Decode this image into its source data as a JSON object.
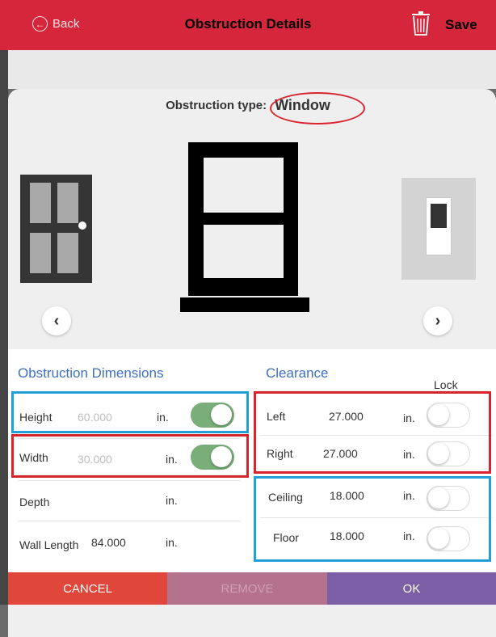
{
  "header": {
    "back_label": "Back",
    "title": "Obstruction Details",
    "save_label": "Save",
    "back_icon": "arrow-left-circle-icon",
    "trash_icon": "trash-icon",
    "color": "#d5263b"
  },
  "obstruction": {
    "type_prefix": "Obstruction type:",
    "type_value": "Window",
    "options": [
      "door",
      "window",
      "outlet"
    ],
    "selected": "window"
  },
  "nav": {
    "prev_glyph": "‹",
    "next_glyph": "›"
  },
  "dimensions": {
    "title": "Obstruction Dimensions",
    "rows": [
      {
        "label": "Height",
        "value": "60.000",
        "unit": "in.",
        "locked": true
      },
      {
        "label": "Width",
        "value": "30.000",
        "unit": "in.",
        "locked": true
      },
      {
        "label": "Depth",
        "value": "",
        "unit": "in."
      },
      {
        "label": "Wall Length",
        "value": "84.000",
        "unit": "in."
      }
    ]
  },
  "clearance": {
    "title": "Clearance",
    "lock_label": "Lock",
    "rows": [
      {
        "label": "Left",
        "value": "27.000",
        "unit": "in.",
        "locked": false
      },
      {
        "label": "Right",
        "value": "27.000",
        "unit": "in.",
        "locked": false
      },
      {
        "label": "Ceiling",
        "value": "18.000",
        "unit": "in.",
        "locked": false
      },
      {
        "label": "Floor",
        "value": "18.000",
        "unit": "in.",
        "locked": false
      }
    ]
  },
  "footer": {
    "cancel_label": "CANCEL",
    "remove_label": "REMOVE",
    "ok_label": "OK"
  },
  "colors": {
    "section_title": "#3e6fc2",
    "toggle_on": "#79ae79",
    "annotation_red": "#d9232e",
    "annotation_blue": "#229fd6",
    "cancel": "#e0473a",
    "remove": "#b5728c",
    "ok": "#7c5fa7"
  }
}
